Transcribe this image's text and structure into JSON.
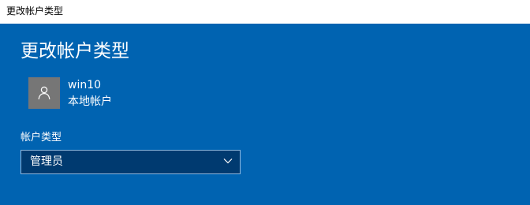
{
  "window": {
    "title": "更改帐户类型"
  },
  "dialog": {
    "title": "更改帐户类型"
  },
  "user": {
    "name": "win10",
    "type": "本地帐户",
    "avatar_icon": "person-icon"
  },
  "account_type": {
    "label": "帐户类型",
    "selected": "管理员"
  },
  "colors": {
    "background": "#0063b1",
    "titlebar": "#ffffff",
    "avatar": "#767676",
    "select_background": "#003a70",
    "select_border": "#8fb8de",
    "text": "#ffffff"
  }
}
